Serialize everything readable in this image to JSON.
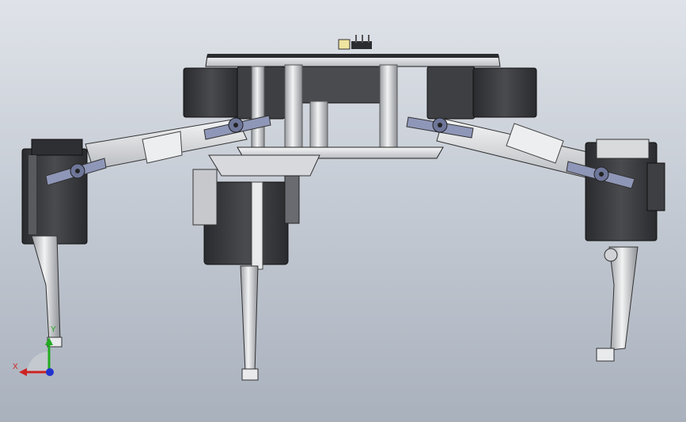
{
  "view": {
    "background_top": "#dfe3e9",
    "background_bottom": "#a9b1bd"
  },
  "triad": {
    "x_label": "X",
    "y_label": "Y",
    "x_color": "#cc2222",
    "y_color": "#22aa22",
    "z_color": "#2233cc"
  },
  "model": {
    "part_dark": "#3a3b3e",
    "part_light": "#e6e8ea",
    "horn_color": "#8f97b8"
  }
}
